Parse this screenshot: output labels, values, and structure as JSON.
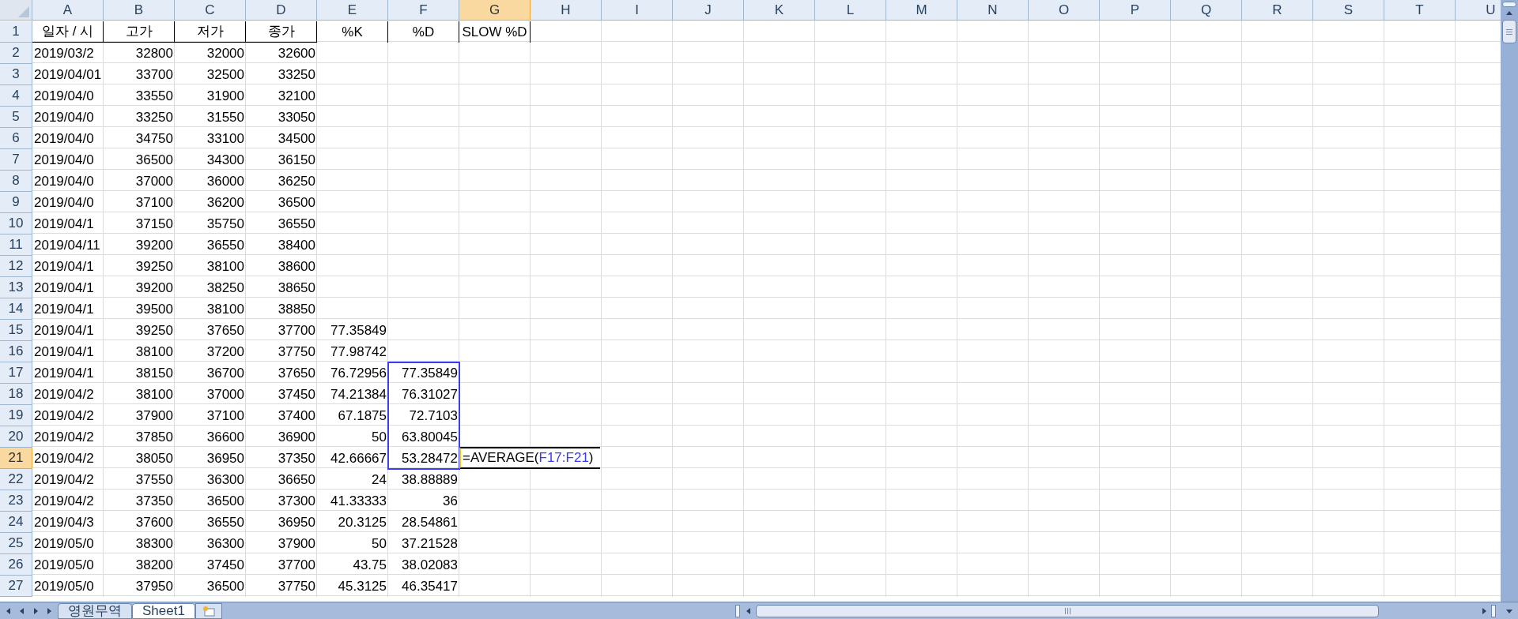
{
  "columns": [
    {
      "label": "A",
      "selected": false
    },
    {
      "label": "B",
      "selected": false
    },
    {
      "label": "C",
      "selected": false
    },
    {
      "label": "D",
      "selected": false
    },
    {
      "label": "E",
      "selected": false
    },
    {
      "label": "F",
      "selected": false
    },
    {
      "label": "G",
      "selected": true
    },
    {
      "label": "H",
      "selected": false
    },
    {
      "label": "I",
      "selected": false
    },
    {
      "label": "J",
      "selected": false
    },
    {
      "label": "K",
      "selected": false
    },
    {
      "label": "L",
      "selected": false
    },
    {
      "label": "M",
      "selected": false
    },
    {
      "label": "N",
      "selected": false
    },
    {
      "label": "O",
      "selected": false
    },
    {
      "label": "P",
      "selected": false
    },
    {
      "label": "Q",
      "selected": false
    },
    {
      "label": "R",
      "selected": false
    },
    {
      "label": "S",
      "selected": false
    },
    {
      "label": "T",
      "selected": false
    },
    {
      "label": "U",
      "selected": false
    }
  ],
  "rows": [
    {
      "number": "1",
      "selected": false,
      "kind": "header",
      "cells": [
        {
          "text": "일자 / 시"
        },
        {
          "text": "고가"
        },
        {
          "text": "저가"
        },
        {
          "text": "종가"
        },
        {
          "text": "%K"
        },
        {
          "text": "%D",
          "range": false
        },
        {
          "text": "SLOW %D"
        }
      ]
    },
    {
      "number": "2",
      "selected": false,
      "kind": "data",
      "cells": [
        {
          "text": "2019/03/2"
        },
        {
          "text": "32800"
        },
        {
          "text": "32000"
        },
        {
          "text": "32600"
        }
      ]
    },
    {
      "number": "3",
      "selected": false,
      "kind": "data",
      "cells": [
        {
          "text": "2019/04/01"
        },
        {
          "text": "33700"
        },
        {
          "text": "32500"
        },
        {
          "text": "33250"
        }
      ]
    },
    {
      "number": "4",
      "selected": false,
      "kind": "data",
      "cells": [
        {
          "text": "2019/04/0"
        },
        {
          "text": "33550"
        },
        {
          "text": "31900"
        },
        {
          "text": "32100"
        }
      ]
    },
    {
      "number": "5",
      "selected": false,
      "kind": "data",
      "cells": [
        {
          "text": "2019/04/0"
        },
        {
          "text": "33250"
        },
        {
          "text": "31550"
        },
        {
          "text": "33050"
        }
      ]
    },
    {
      "number": "6",
      "selected": false,
      "kind": "data",
      "cells": [
        {
          "text": "2019/04/0"
        },
        {
          "text": "34750"
        },
        {
          "text": "33100"
        },
        {
          "text": "34500"
        }
      ]
    },
    {
      "number": "7",
      "selected": false,
      "kind": "data",
      "cells": [
        {
          "text": "2019/04/0"
        },
        {
          "text": "36500"
        },
        {
          "text": "34300"
        },
        {
          "text": "36150"
        }
      ]
    },
    {
      "number": "8",
      "selected": false,
      "kind": "data",
      "cells": [
        {
          "text": "2019/04/0"
        },
        {
          "text": "37000"
        },
        {
          "text": "36000"
        },
        {
          "text": "36250"
        }
      ]
    },
    {
      "number": "9",
      "selected": false,
      "kind": "data",
      "cells": [
        {
          "text": "2019/04/0"
        },
        {
          "text": "37100"
        },
        {
          "text": "36200"
        },
        {
          "text": "36500"
        }
      ]
    },
    {
      "number": "10",
      "selected": false,
      "kind": "data",
      "cells": [
        {
          "text": "2019/04/1"
        },
        {
          "text": "37150"
        },
        {
          "text": "35750"
        },
        {
          "text": "36550"
        }
      ]
    },
    {
      "number": "11",
      "selected": false,
      "kind": "data",
      "cells": [
        {
          "text": "2019/04/11"
        },
        {
          "text": "39200"
        },
        {
          "text": "36550"
        },
        {
          "text": "38400"
        }
      ]
    },
    {
      "number": "12",
      "selected": false,
      "kind": "data",
      "cells": [
        {
          "text": "2019/04/1"
        },
        {
          "text": "39250"
        },
        {
          "text": "38100"
        },
        {
          "text": "38600"
        }
      ]
    },
    {
      "number": "13",
      "selected": false,
      "kind": "data",
      "cells": [
        {
          "text": "2019/04/1"
        },
        {
          "text": "39200"
        },
        {
          "text": "38250"
        },
        {
          "text": "38650"
        }
      ]
    },
    {
      "number": "14",
      "selected": false,
      "kind": "data",
      "cells": [
        {
          "text": "2019/04/1"
        },
        {
          "text": "39500"
        },
        {
          "text": "38100"
        },
        {
          "text": "38850"
        }
      ]
    },
    {
      "number": "15",
      "selected": false,
      "kind": "data",
      "cells": [
        {
          "text": "2019/04/1"
        },
        {
          "text": "39250"
        },
        {
          "text": "37650"
        },
        {
          "text": "37700"
        },
        {
          "text": "77.35849"
        }
      ]
    },
    {
      "number": "16",
      "selected": false,
      "kind": "data",
      "cells": [
        {
          "text": "2019/04/1"
        },
        {
          "text": "38100"
        },
        {
          "text": "37200"
        },
        {
          "text": "37750"
        },
        {
          "text": "77.98742"
        }
      ]
    },
    {
      "number": "17",
      "selected": false,
      "kind": "data",
      "cells": [
        {
          "text": "2019/04/1"
        },
        {
          "text": "38150"
        },
        {
          "text": "36700"
        },
        {
          "text": "37650"
        },
        {
          "text": "76.72956"
        },
        {
          "text": "77.35849",
          "range": true
        }
      ]
    },
    {
      "number": "18",
      "selected": false,
      "kind": "data",
      "cells": [
        {
          "text": "2019/04/2"
        },
        {
          "text": "38100"
        },
        {
          "text": "37000"
        },
        {
          "text": "37450"
        },
        {
          "text": "74.21384"
        },
        {
          "text": "76.31027",
          "range": true
        }
      ]
    },
    {
      "number": "19",
      "selected": false,
      "kind": "data",
      "cells": [
        {
          "text": "2019/04/2"
        },
        {
          "text": "37900"
        },
        {
          "text": "37100"
        },
        {
          "text": "37400"
        },
        {
          "text": "67.1875"
        },
        {
          "text": "72.7103",
          "range": true
        }
      ]
    },
    {
      "number": "20",
      "selected": false,
      "kind": "data",
      "cells": [
        {
          "text": "2019/04/2"
        },
        {
          "text": "37850"
        },
        {
          "text": "36600"
        },
        {
          "text": "36900"
        },
        {
          "text": "50"
        },
        {
          "text": "63.80045",
          "range": true
        }
      ]
    },
    {
      "number": "21",
      "selected": true,
      "kind": "data",
      "cells": [
        {
          "text": "2019/04/2"
        },
        {
          "text": "38050"
        },
        {
          "text": "36950"
        },
        {
          "text": "37350"
        },
        {
          "text": "42.66667"
        },
        {
          "text": "53.28472",
          "range": true
        },
        {
          "formula": {
            "before": "=AVERAGE(",
            "ref": "F17:F21",
            "after": ")"
          }
        }
      ]
    },
    {
      "number": "22",
      "selected": false,
      "kind": "data",
      "cells": [
        {
          "text": "2019/04/2"
        },
        {
          "text": "37550"
        },
        {
          "text": "36300"
        },
        {
          "text": "36650"
        },
        {
          "text": "24"
        },
        {
          "text": "38.88889",
          "range": false
        }
      ]
    },
    {
      "number": "23",
      "selected": false,
      "kind": "data",
      "cells": [
        {
          "text": "2019/04/2"
        },
        {
          "text": "37350"
        },
        {
          "text": "36500"
        },
        {
          "text": "37300"
        },
        {
          "text": "41.33333"
        },
        {
          "text": "36",
          "range": false
        }
      ]
    },
    {
      "number": "24",
      "selected": false,
      "kind": "data",
      "cells": [
        {
          "text": "2019/04/3"
        },
        {
          "text": "37600"
        },
        {
          "text": "36550"
        },
        {
          "text": "36950"
        },
        {
          "text": "20.3125"
        },
        {
          "text": "28.54861",
          "range": false
        }
      ]
    },
    {
      "number": "25",
      "selected": false,
      "kind": "data",
      "cells": [
        {
          "text": "2019/05/0"
        },
        {
          "text": "38300"
        },
        {
          "text": "36300"
        },
        {
          "text": "37900"
        },
        {
          "text": "50"
        },
        {
          "text": "37.21528",
          "range": false
        }
      ]
    },
    {
      "number": "26",
      "selected": false,
      "kind": "data",
      "cells": [
        {
          "text": "2019/05/0"
        },
        {
          "text": "38200"
        },
        {
          "text": "37450"
        },
        {
          "text": "37700"
        },
        {
          "text": "43.75"
        },
        {
          "text": "38.02083",
          "range": false
        }
      ]
    },
    {
      "number": "27",
      "selected": false,
      "kind": "data",
      "cells": [
        {
          "text": "2019/05/0"
        },
        {
          "text": "37950"
        },
        {
          "text": "36500"
        },
        {
          "text": "37750"
        },
        {
          "text": "45.3125"
        },
        {
          "text": "46.35417",
          "range": false
        }
      ]
    }
  ],
  "sheet_tabs": [
    {
      "label": "영원무역",
      "selected": false
    },
    {
      "label": "Sheet1",
      "selected": true
    }
  ]
}
